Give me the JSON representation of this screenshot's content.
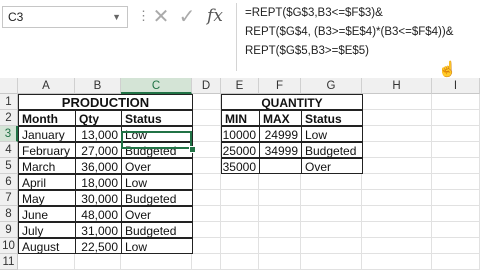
{
  "namebox": {
    "value": "C3"
  },
  "formula_bar": {
    "lines": [
      "=REPT($G$3,B3<=$F$3)&",
      "REPT($G$4, (B3>=$E$4)*(B3<=$F$4))&",
      "REPT($G$5,B3>=$E$5)"
    ],
    "fx_label": "fx"
  },
  "columns": [
    "A",
    "B",
    "C",
    "D",
    "E",
    "F",
    "G",
    "H",
    "I"
  ],
  "rows": [
    "1",
    "2",
    "3",
    "4",
    "5",
    "6",
    "7",
    "8",
    "9",
    "10",
    "11"
  ],
  "production": {
    "title": "PRODUCTION",
    "headers": [
      "Month",
      "Qty",
      "Status"
    ],
    "data": [
      [
        "January",
        "13,000",
        "Low"
      ],
      [
        "February",
        "27,000",
        "Budgeted"
      ],
      [
        "March",
        "36,000",
        "Over"
      ],
      [
        "April",
        "18,000",
        "Low"
      ],
      [
        "May",
        "30,000",
        "Budgeted"
      ],
      [
        "June",
        "48,000",
        "Over"
      ],
      [
        "July",
        "31,000",
        "Budgeted"
      ],
      [
        "August",
        "22,500",
        "Low"
      ]
    ]
  },
  "quantity": {
    "title": "QUANTITY",
    "headers": [
      "MIN",
      "MAX",
      "Status"
    ],
    "data": [
      [
        "10000",
        "24999",
        "Low"
      ],
      [
        "25000",
        "34999",
        "Budgeted"
      ],
      [
        "35000",
        "",
        "Over"
      ]
    ]
  },
  "colors": {
    "accent": "#217346",
    "header_bg": "#f0f0f0"
  }
}
